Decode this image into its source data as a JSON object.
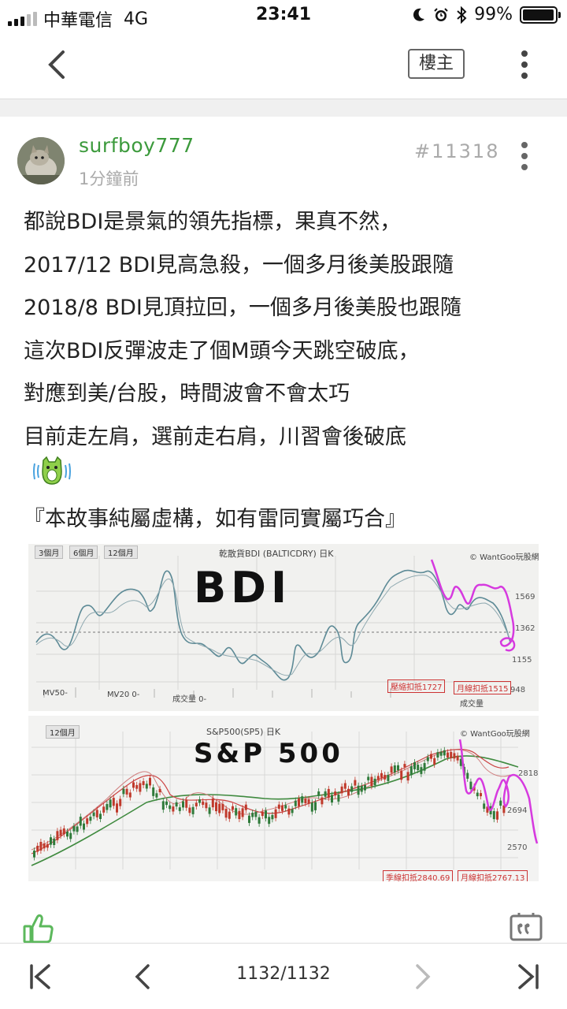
{
  "status_bar": {
    "carrier": "中華電信",
    "network": "4G",
    "time": "23:41",
    "battery": "99%"
  },
  "nav": {
    "op_label": "樓主"
  },
  "post": {
    "username": "surfboy777",
    "time_ago": "1分鐘前",
    "floor": "#11318",
    "lines": [
      "都說BDI是景氣的領先指標，果真不然，",
      "2017/12 BDI見高急殺，一個多月後美股跟隨",
      "2018/8 BDI見頂拉回，一個多月後美股也跟隨",
      "這次BDI反彈波走了個M頭今天跳空破底，",
      "對應到美/台股，時間波會不會太巧",
      "目前走左肩，選前走右肩，川習會後破底"
    ],
    "disclaimer": "『本故事純屬虛構，如有雷同實屬巧合』"
  },
  "chart_bdi": {
    "tabs": [
      "3個月",
      "6個月",
      "12個月"
    ],
    "title": "乾散貨BDI (BALTICDRY) 日K",
    "watermark": "© WantGoo玩股網",
    "annotation": "BDI",
    "yticks": [
      "1569",
      "1362",
      "1155",
      "948"
    ],
    "legend": [
      "MV50-",
      "MV20 0-",
      "成交量 0-",
      "成交量"
    ],
    "boxes": [
      "壓縮扣抵1727",
      "月線扣抵1515"
    ]
  },
  "chart_sp": {
    "tab": "12個月",
    "title": "S&P500(SP5) 日K",
    "watermark": "© WantGoo玩股網",
    "annotation": "S&P 500",
    "yticks": [
      "2818",
      "2694",
      "2570"
    ],
    "boxes": [
      "季線扣抵2840.69",
      "月線扣抵2767.13"
    ]
  },
  "pager": {
    "label": "1132/1132"
  },
  "colors": {
    "username": "#3c9a3c",
    "annotation_magenta": "#d63adf",
    "bdi_line": "#5d8a96",
    "candle_red": "#c0392b",
    "candle_green": "#2f7a3a"
  }
}
